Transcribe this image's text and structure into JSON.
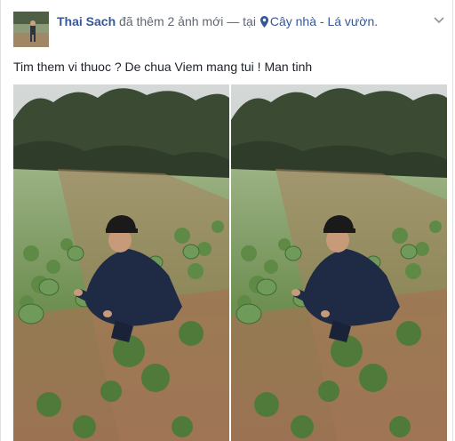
{
  "post": {
    "author": "Thai Sach",
    "action": "đã thêm 2 ảnh mới",
    "separator": "— tại",
    "location": "Cây nhà - Lá vườn.",
    "caption": "Tim them vi thuoc ? De chua Viem mang tui ! Man tinh",
    "menu_icon": "chevron-down-icon",
    "location_icon": "map-pin-icon"
  },
  "photos": [
    {
      "subject": "man-crouching-in-watermelon-field"
    },
    {
      "subject": "man-crouching-in-watermelon-field"
    }
  ],
  "colors": {
    "link": "#365899",
    "meta_text": "#616770",
    "body_text": "#1d2129"
  }
}
